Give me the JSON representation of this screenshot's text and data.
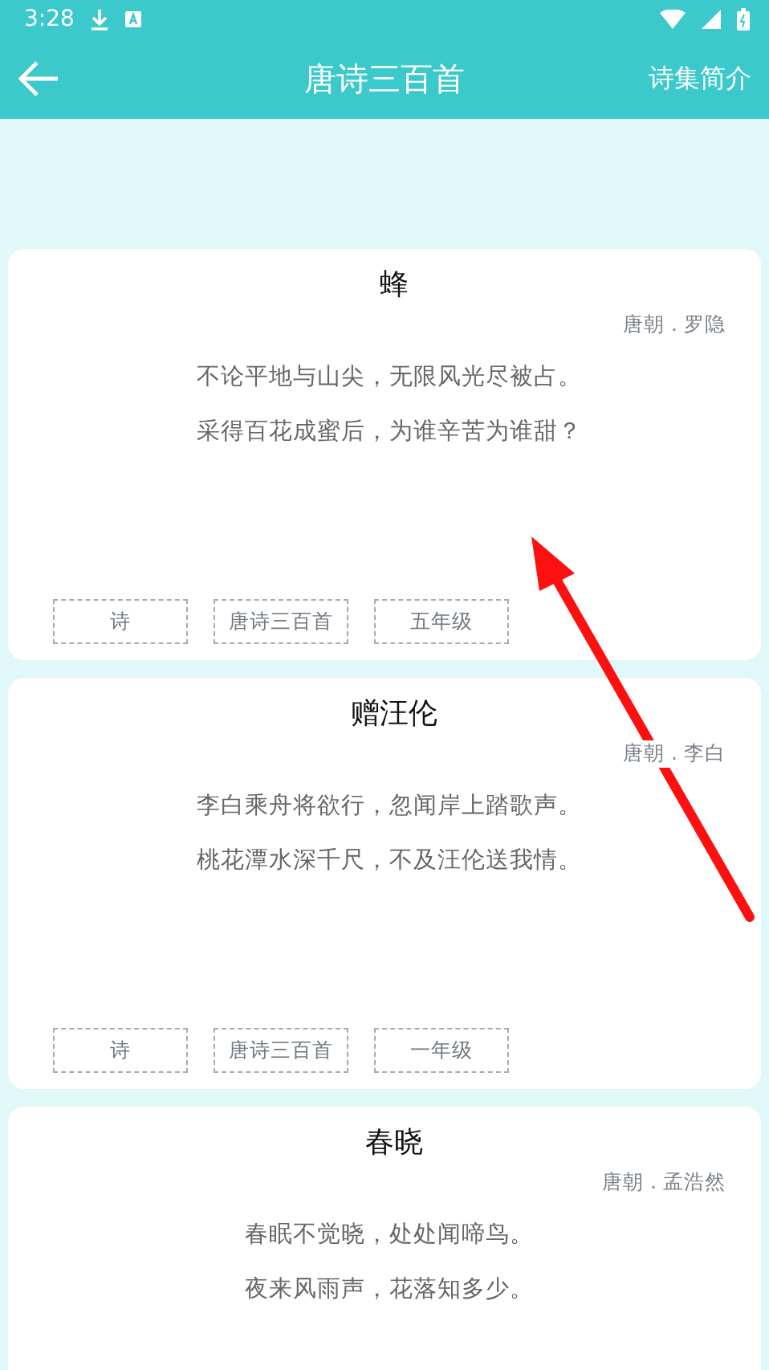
{
  "status_bar": {
    "time": "3:28"
  },
  "app_bar": {
    "title": "唐诗三百首",
    "action": "诗集简介"
  },
  "poems": [
    {
      "title": "蜂",
      "author": "唐朝 . 罗隐",
      "lines": [
        "不论平地与山尖，无限风光尽被占。",
        "采得百花成蜜后，为谁辛苦为谁甜？"
      ],
      "tags": [
        "诗",
        "唐诗三百首",
        "五年级"
      ]
    },
    {
      "title": "赠汪伦",
      "author": "唐朝 . 李白",
      "lines": [
        "李白乘舟将欲行，忽闻岸上踏歌声。",
        "桃花潭水深千尺，不及汪伦送我情。"
      ],
      "tags": [
        "诗",
        "唐诗三百首",
        "一年级"
      ]
    },
    {
      "title": "春晓",
      "author": "唐朝 . 孟浩然",
      "lines": [
        "春眠不觉晓，处处闻啼鸟。",
        "夜来风雨声，花落知多少。"
      ]
    }
  ]
}
